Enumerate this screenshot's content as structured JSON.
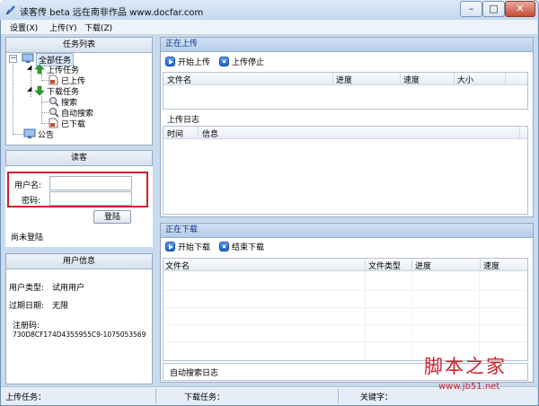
{
  "window": {
    "title": "读客传 beta   远在南非作品 www.docfar.com",
    "min_glyph": "–",
    "max_glyph": "□",
    "close_glyph": "✕"
  },
  "menu": {
    "items": [
      {
        "label": "设置(X)"
      },
      {
        "label": "上传(Y)"
      },
      {
        "label": "下载(Z)"
      }
    ]
  },
  "left": {
    "task_panel": {
      "title": "任务列表",
      "tree": {
        "all": "全部任务",
        "upload_tasks": "上传任务",
        "uploaded": "已上传",
        "download_tasks": "下载任务",
        "search": "搜索",
        "auto_search": "自动搜索",
        "downloaded": "已下载",
        "announce": "公告"
      }
    },
    "login_panel": {
      "title": "读客",
      "username_label": "用户名:",
      "username_value": "",
      "password_label": "密码:",
      "password_value": "",
      "login_button": "登陆",
      "status": "尚未登陆"
    },
    "user_panel": {
      "title": "用户信息",
      "type_label": "用户类型:",
      "type_value": "试用用户",
      "expiry_label": "过期日期:",
      "expiry_value": "无限",
      "regcode_label": "注册码:",
      "regcode_value": "730D8CF174D4355955C9-1075053569"
    }
  },
  "upload": {
    "header": "正在上传",
    "start_button": "开始上传",
    "stop_button": "上传停止",
    "columns": [
      "文件名",
      "进度",
      "速度",
      "大小"
    ],
    "log_title": "上传日志",
    "log_columns": [
      "时间",
      "信息"
    ]
  },
  "download": {
    "header": "正在下载",
    "start_button": "开始下载",
    "stop_button": "结束下载",
    "columns": [
      "文件名",
      "文件类型",
      "进度",
      "速度"
    ],
    "log_title": "自动搜索日志"
  },
  "status": {
    "upload_task": "上传任务：",
    "download_task": "下载任务：",
    "keyword": "关键字："
  },
  "watermark": {
    "text": "脚本之家",
    "url": "www.jb51.net"
  },
  "colors": {
    "accent_blue": "#08308a",
    "highlight_red": "#d0202a",
    "upload_arrow": "#2e9e2e",
    "download_arrow": "#2e9e2e"
  }
}
